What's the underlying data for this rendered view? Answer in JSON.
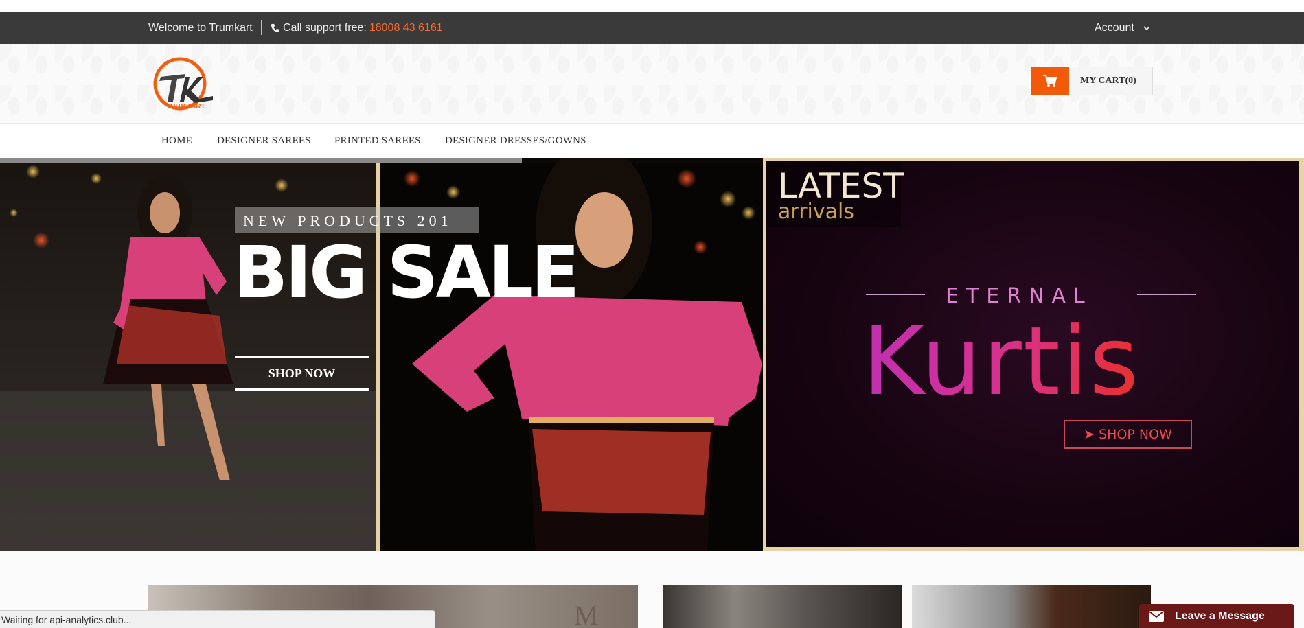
{
  "topbar": {
    "welcome": "Welcome to Trumkart",
    "support_label": "Call support free:",
    "support_phone": "18008 43 6161",
    "account_label": "Account"
  },
  "header": {
    "logo_text": "TRUMKART",
    "cart_label": "MY CART(0)"
  },
  "nav": {
    "items": [
      "HOME",
      "DESIGNER SAREES",
      "PRINTED SAREES",
      "DESIGNER DRESSES/GOWNS"
    ]
  },
  "banner_left": {
    "tagline": "NEW PRODUCTS 201",
    "headline": "BIG SALE",
    "cta": "SHOP NOW"
  },
  "banner_right": {
    "latest": "LATEST",
    "arrivals": "arrivals",
    "eternal": "ETERNAL",
    "kurtis": "Kurtis",
    "cta": "➤ SHOP NOW"
  },
  "status_bar": {
    "text": "Waiting for api-analytics.club..."
  },
  "chat": {
    "label": "Leave a Message"
  },
  "colors": {
    "accent": "#f25a0a",
    "topbar_bg": "#3a3a3a",
    "chat_bg": "#6b1818"
  }
}
